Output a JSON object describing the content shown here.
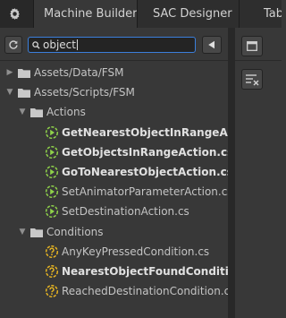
{
  "tabs": [
    {
      "label": "Machine Builder",
      "active": true
    },
    {
      "label": "SAC Designer",
      "active": false
    },
    {
      "label": "Tab",
      "active": false
    }
  ],
  "search": {
    "value": "object"
  },
  "tree": [
    {
      "label": "Assets/Data/FSM",
      "type": "folder",
      "depth": 0,
      "expanded": false,
      "bold": false
    },
    {
      "label": "Assets/Scripts/FSM",
      "type": "folder",
      "depth": 0,
      "expanded": true,
      "bold": false
    },
    {
      "label": "Actions",
      "type": "folder",
      "depth": 1,
      "expanded": true,
      "bold": false
    },
    {
      "label": "GetNearestObjectInRangeAction",
      "type": "action",
      "depth": 2,
      "bold": true
    },
    {
      "label": "GetObjectsInRangeAction.cs",
      "type": "action",
      "depth": 2,
      "bold": true
    },
    {
      "label": "GoToNearestObjectAction.cs",
      "type": "action",
      "depth": 2,
      "bold": true
    },
    {
      "label": "SetAnimatorParameterAction.cs",
      "type": "action",
      "depth": 2,
      "bold": false
    },
    {
      "label": "SetDestinationAction.cs",
      "type": "action",
      "depth": 2,
      "bold": false
    },
    {
      "label": "Conditions",
      "type": "folder",
      "depth": 1,
      "expanded": true,
      "bold": false
    },
    {
      "label": "AnyKeyPressedCondition.cs",
      "type": "condition",
      "depth": 2,
      "bold": false
    },
    {
      "label": "NearestObjectFoundCondition.c",
      "type": "condition",
      "depth": 2,
      "bold": true
    },
    {
      "label": "ReachedDestinationCondition.cs",
      "type": "condition",
      "depth": 2,
      "bold": false
    }
  ],
  "colors": {
    "action_icon": "#8fd24a",
    "condition_icon": "#e6b422",
    "folder": "#c8c8c8",
    "search_focus": "#3b7fdc"
  }
}
